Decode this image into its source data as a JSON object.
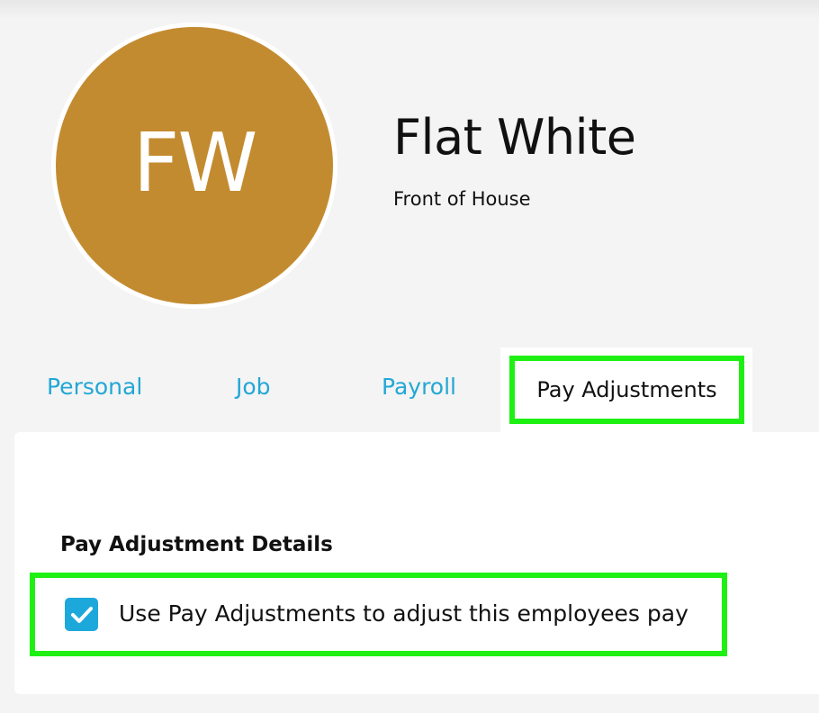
{
  "employee": {
    "initials": "FW",
    "name": "Flat White",
    "department": "Front of House",
    "avatar_color": "#c38b30"
  },
  "tabs": [
    {
      "label": "Personal",
      "active": false
    },
    {
      "label": "Job",
      "active": false
    },
    {
      "label": "Payroll",
      "active": false
    },
    {
      "label": "Pay Adjustments",
      "active": true
    }
  ],
  "pay_adjustments": {
    "section_title": "Pay Adjustment Details",
    "use_pay_adjustments": {
      "label": "Use Pay Adjustments to adjust this employees pay",
      "checked": true,
      "icon": "checkmark-icon"
    }
  },
  "colors": {
    "tab_link": "#22a7d6",
    "checkbox": "#1da8dc",
    "highlight": "#1ef014"
  }
}
